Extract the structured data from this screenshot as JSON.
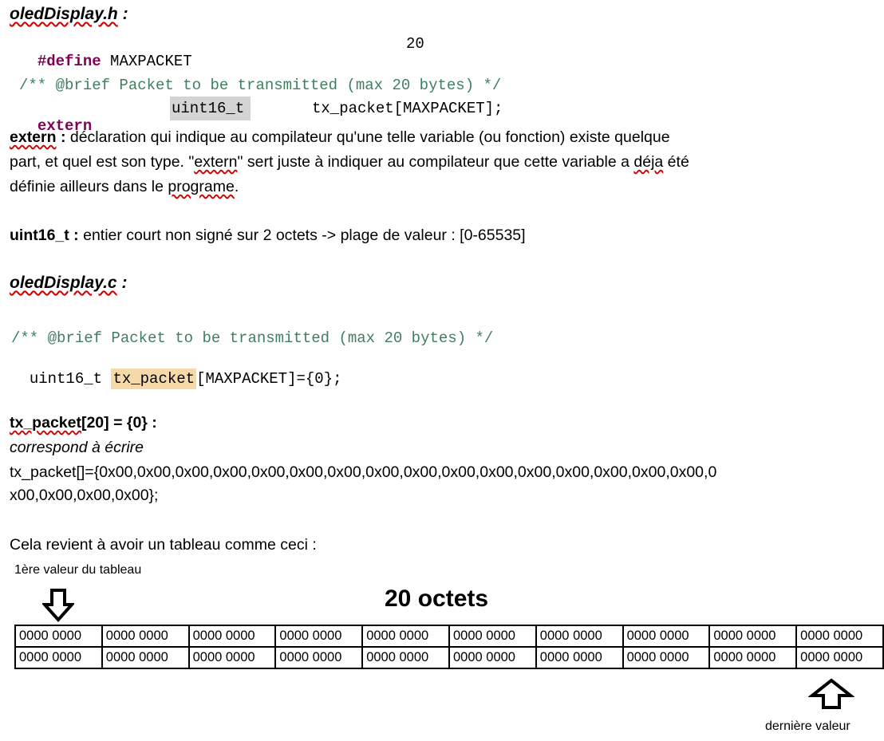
{
  "header_h": {
    "filename": "oledDisplay.h",
    "colon": " :"
  },
  "code_h": {
    "define_kw": "#define",
    "define_name": " MAXPACKET",
    "define_value": "20",
    "comment": "/** @brief Packet to be transmitted (max 20 bytes) */",
    "extern_kw": "extern",
    "type": "uint16_t",
    "decl": "tx_packet[MAXPACKET];"
  },
  "extern_para": {
    "term": "extern",
    "colon": " :",
    "line1": " déclaration qui indique au compilateur qu'une telle variable (ou fonction) existe quelque",
    "line2_a": "part, et quel est son type. \"",
    "line2_term": "extern",
    "line2_b": "\" sert juste à indiquer au compilateur que cette variable a ",
    "line2_deja": "déja",
    "line2_c": " été",
    "line3_a": "définie ailleurs dans le ",
    "line3_term": "programe",
    "line3_b": "."
  },
  "uint_para": {
    "term": "uint16_t :",
    "text": "   entier court non signé sur 2 octets -> plage de valeur : [0-65535]"
  },
  "header_c": {
    "filename": "oledDisplay.c",
    "colon": " :"
  },
  "code_c": {
    "comment": "/** @brief Packet to be transmitted (max 20 bytes) */",
    "type": "uint16_t",
    "name": "tx_packet",
    "rest": "[MAXPACKET]={0};"
  },
  "init_para": {
    "term_a": "tx_packet",
    "term_b": "[20] = {0} :",
    "italic": " correspond à écrire",
    "line1": "tx_packet[]={0x00,0x00,0x00,0x00,0x00,0x00,0x00,0x00,0x00,0x00,0x00,0x00,0x00,0x00,0x00,0x00,0",
    "line2": "x00,0x00,0x00,0x00};"
  },
  "table_intro": "Cela revient à avoir un tableau comme ceci :",
  "first_label": "1ère valeur du tableau",
  "size_label": "20 octets",
  "last_label": "dernière valeur",
  "table": {
    "rows": [
      [
        "0000 0000",
        "0000 0000",
        "0000 0000",
        "0000 0000",
        "0000 0000",
        "0000 0000",
        "0000 0000",
        "0000 0000",
        "0000 0000",
        "0000 0000"
      ],
      [
        "0000 0000",
        "0000 0000",
        "0000 0000",
        "0000 0000",
        "0000 0000",
        "0000 0000",
        "0000 0000",
        "0000 0000",
        "0000 0000",
        "0000 0000"
      ]
    ]
  },
  "icons": {
    "down": "down-arrow-icon",
    "up": "up-arrow-icon"
  }
}
